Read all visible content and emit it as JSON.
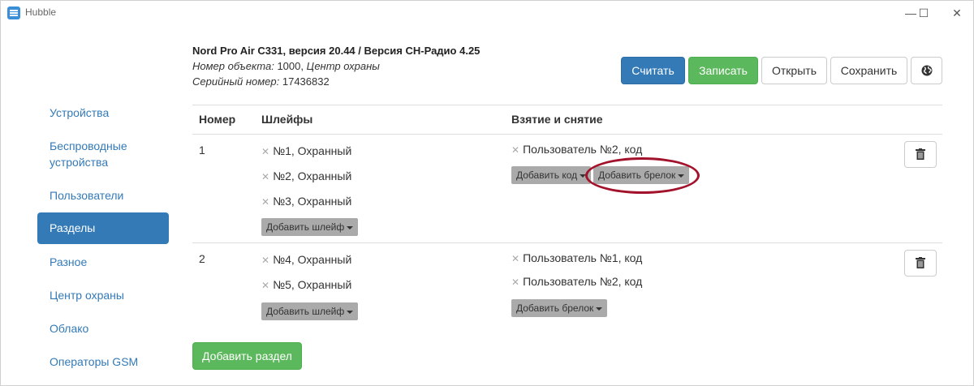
{
  "window": {
    "title": "Hubble",
    "controls": [
      "—",
      "☐",
      "✕"
    ]
  },
  "header": {
    "model": "Nord Pro Air C331, версия 20.44 / Версия CH-Радио 4.25",
    "object_label": "Номер объекта:",
    "object_value": " 1000, ",
    "center_label": "Центр охраны",
    "serial_label": "Серийный номер:",
    "serial_value": " 17436832"
  },
  "toolbar": {
    "read_label": "Считать",
    "write_label": "Записать",
    "open_label": "Открыть",
    "save_label": "Сохранить",
    "globe_icon": "globe-icon"
  },
  "sidebar": {
    "items": [
      {
        "label": "Устройства"
      },
      {
        "label": "Беспроводные устройства"
      },
      {
        "label": "Пользователи"
      },
      {
        "label": "Разделы",
        "active": true
      },
      {
        "label": "Разное"
      },
      {
        "label": "Центр охраны"
      },
      {
        "label": "Облако"
      },
      {
        "label": "Операторы GSM"
      }
    ]
  },
  "table": {
    "headers": {
      "number": "Номер",
      "loops": "Шлейфы",
      "arming": "Взятие и снятие"
    },
    "rows": [
      {
        "number": "1",
        "loops": [
          "№1, Охранный",
          "№2, Охранный",
          "№3, Охранный"
        ],
        "add_loop": "Добавить шлейф",
        "users": [
          "Пользователь №2, код"
        ],
        "add_code": "Добавить код",
        "add_fob": "Добавить брелок"
      },
      {
        "number": "2",
        "loops": [
          "№4, Охранный",
          "№5, Охранный"
        ],
        "add_loop": "Добавить шлейф",
        "users": [
          "Пользователь №1, код",
          "Пользователь №2, код"
        ],
        "add_fob": "Добавить брелок"
      }
    ]
  },
  "add_section_label": "Добавить раздел",
  "colors": {
    "primary": "#337ab7",
    "success": "#5cb85c",
    "highlight": "#a3122b"
  }
}
